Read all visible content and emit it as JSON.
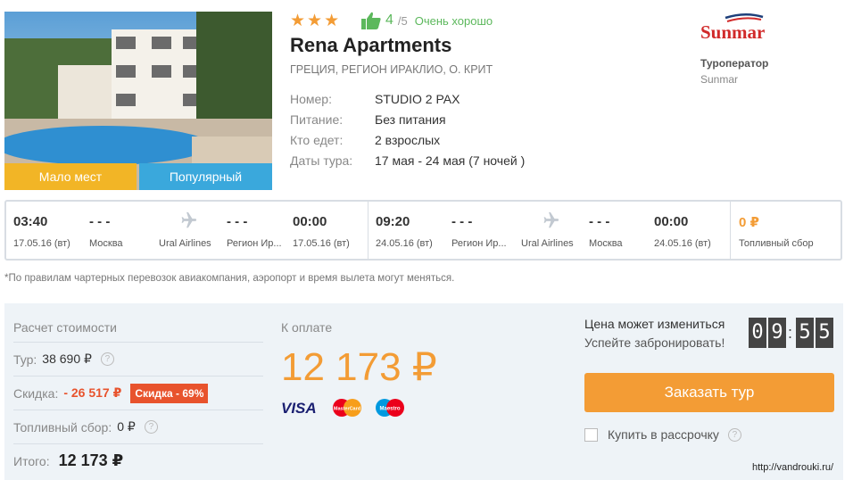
{
  "badges": {
    "few_places": "Мало мест",
    "popular": "Популярный"
  },
  "hotel": {
    "stars": "★★★",
    "rating_score": "4",
    "rating_max": "/5",
    "rating_text": "Очень хорошо",
    "name": "Rena Apartments",
    "location": "ГРЕЦИЯ, РЕГИОН ИРАКЛИО, О. КРИТ",
    "details": [
      {
        "label": "Номер:",
        "value": "STUDIO 2 PAX"
      },
      {
        "label": "Питание:",
        "value": "Без питания"
      },
      {
        "label": "Кто едет:",
        "value": "2 взрослых"
      },
      {
        "label": "Даты тура:",
        "value": "17 мая - 24 мая (7 ночей )"
      }
    ]
  },
  "operator": {
    "logo_text": "Sunmar",
    "title": "Туроператор",
    "name": "Sunmar"
  },
  "flights": {
    "outbound": {
      "dep_time": "03:40",
      "dep_date": "17.05.16 (вт)",
      "dep_dash": "- - -",
      "dep_city": "Москва",
      "airline": "Ural Airlines",
      "arr_dash": "- - -",
      "arr_city": "Регион Ир...",
      "arr_time": "00:00",
      "arr_date": "17.05.16 (вт)"
    },
    "return": {
      "dep_time": "09:20",
      "dep_date": "24.05.16 (вт)",
      "dep_dash": "- - -",
      "dep_city": "Регион Ир...",
      "airline": "Ural Airlines",
      "arr_dash": "- - -",
      "arr_city": "Москва",
      "arr_time": "00:00",
      "arr_date": "24.05.16 (вт)"
    },
    "fuel_amount": "0 ₽",
    "fuel_label": "Топливный сбор"
  },
  "note": "*По правилам чартерных перевозок авиакомпания, аэропорт и время вылета могут меняться.",
  "calc": {
    "title": "Расчет стоимости",
    "tour_label": "Тур:",
    "tour_value": "38 690 ₽",
    "discount_label": "Скидка:",
    "discount_value": "- 26 517 ₽",
    "discount_badge": "Скидка - 69%",
    "fuel_label": "Топливный сбор:",
    "fuel_value": "0 ₽",
    "total_label": "Итого:",
    "total_value": "12 173 ₽",
    "help": "?"
  },
  "payment": {
    "title": "К оплате",
    "amount": "12 173 ₽",
    "cards": [
      "VISA",
      "MasterCard",
      "Maestro"
    ]
  },
  "booking": {
    "price_change": "Цена может измениться",
    "hurry": "Успейте забронировать!",
    "timer_min": [
      "0",
      "9"
    ],
    "timer_sec": [
      "5",
      "5"
    ],
    "timer_sep": ":",
    "button": "Заказать тур",
    "installment": "Купить в рассрочку"
  },
  "watermark": "http://vandrouki.ru/",
  "colors": {
    "accent_orange": "#f39c35",
    "discount_red": "#e8532d",
    "badge_yellow": "#f2b526",
    "badge_blue": "#3aa8dc",
    "rating_green": "#5cb85c"
  }
}
